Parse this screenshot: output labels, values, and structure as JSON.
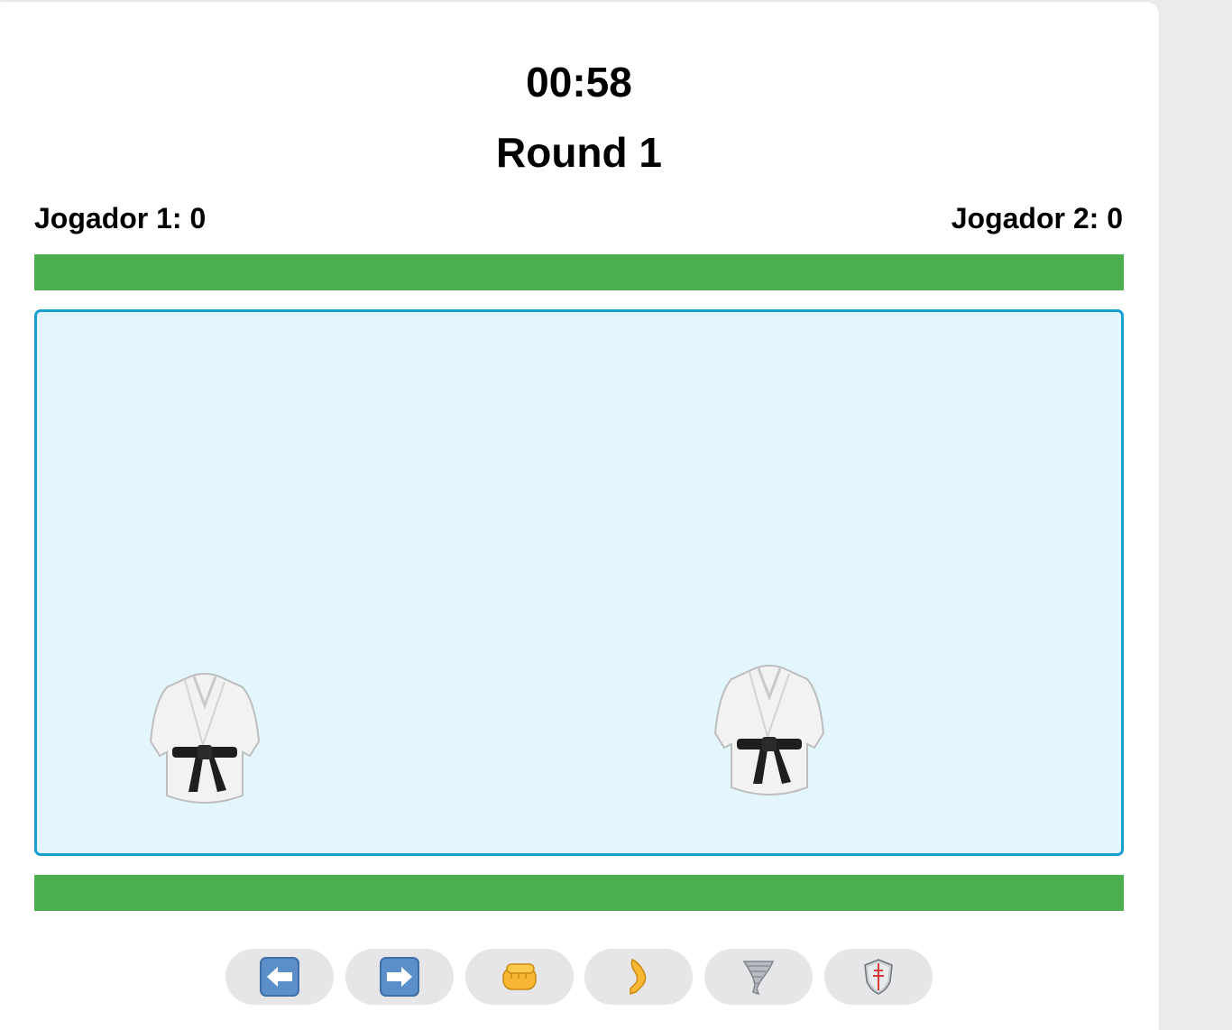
{
  "timer": "00:58",
  "round_label": "Round 1",
  "players": [
    {
      "score_label": "Jogador 1: 0",
      "health_fraction": 1.0
    },
    {
      "score_label": "Jogador 2: 0",
      "health_fraction": 1.0
    }
  ],
  "fighters": [
    {
      "icon": "martial-arts-uniform-icon"
    },
    {
      "icon": "martial-arts-uniform-icon"
    }
  ],
  "controls": [
    {
      "icon": "left-arrow-icon"
    },
    {
      "icon": "right-arrow-icon"
    },
    {
      "icon": "punch-fist-icon"
    },
    {
      "icon": "kick-leg-icon"
    },
    {
      "icon": "tornado-special-icon"
    },
    {
      "icon": "shield-defend-icon"
    }
  ],
  "colors": {
    "health": "#4caf50",
    "arena_bg": "#e3f5fd",
    "arena_border": "#1a9fd4",
    "button_bg": "#e6e6e8"
  }
}
